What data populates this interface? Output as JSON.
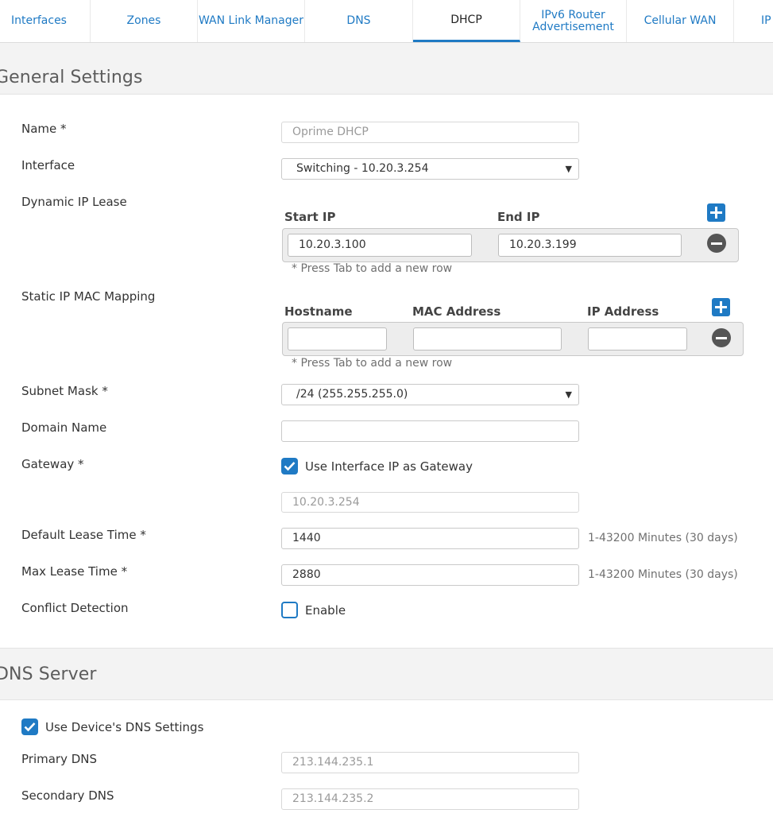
{
  "tabs": [
    {
      "label": "Interfaces"
    },
    {
      "label": "Zones"
    },
    {
      "label": "WAN Link Manager"
    },
    {
      "label": "DNS"
    },
    {
      "label": "DHCP"
    },
    {
      "label_line1": "IPv6 Router",
      "label_line2": "Advertisement"
    },
    {
      "label": "Cellular WAN"
    },
    {
      "label": "IP"
    }
  ],
  "active_tab": "DHCP",
  "general": {
    "title": "General Settings",
    "name": {
      "label": "Name *",
      "placeholder": "Oprime DHCP"
    },
    "interface": {
      "label": "Interface",
      "value": "Switching - 10.20.3.254"
    },
    "dynamic_lease": {
      "label": "Dynamic IP Lease",
      "col_start": "Start IP",
      "col_end": "End IP",
      "rows": [
        {
          "start": "10.20.3.100",
          "end": "10.20.3.199"
        }
      ],
      "note": "* Press Tab to add a new row"
    },
    "static_mapping": {
      "label": "Static IP MAC Mapping",
      "col_hostname": "Hostname",
      "col_mac": "MAC Address",
      "col_ip": "IP Address",
      "rows": [
        {
          "hostname": "",
          "mac": "",
          "ip": ""
        }
      ],
      "note": "* Press Tab to add a new row"
    },
    "subnet_mask": {
      "label": "Subnet Mask *",
      "value": "/24 (255.255.255.0)"
    },
    "domain_name": {
      "label": "Domain Name",
      "value": ""
    },
    "gateway": {
      "label": "Gateway *",
      "use_interface_label": "Use Interface IP as Gateway",
      "use_interface_checked": true,
      "value": "10.20.3.254"
    },
    "default_lease": {
      "label": "Default Lease Time *",
      "value": "1440",
      "hint": "1-43200 Minutes (30 days)"
    },
    "max_lease": {
      "label": "Max Lease Time *",
      "value": "2880",
      "hint": "1-43200 Minutes (30 days)"
    },
    "conflict_detection": {
      "label": "Conflict Detection",
      "enable_label": "Enable",
      "checked": false
    }
  },
  "dns": {
    "title": "DNS Server",
    "use_device_label": "Use Device's DNS Settings",
    "use_device_checked": true,
    "primary": {
      "label": "Primary DNS",
      "value": "213.144.235.1"
    },
    "secondary": {
      "label": "Secondary DNS",
      "value": "213.144.235.2"
    }
  },
  "colors": {
    "accent": "#1f7ac4",
    "section_bg": "#f3f3f3",
    "row_bg": "#ededed"
  }
}
